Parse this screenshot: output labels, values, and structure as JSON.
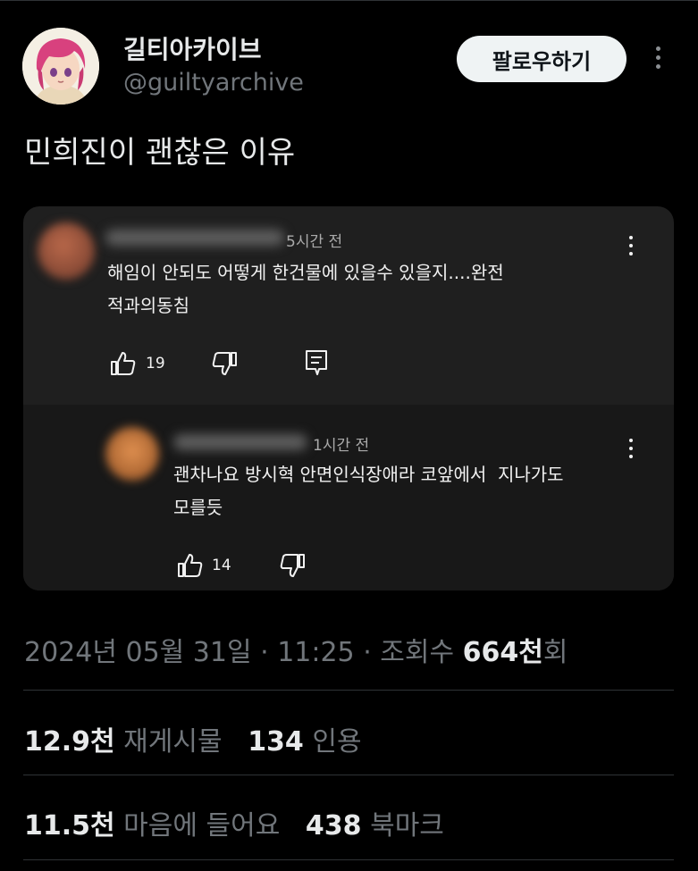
{
  "tweet": {
    "display_name": "길티아카이브",
    "handle": "@guiltyarchive",
    "follow_label": "팔로우하기",
    "text": "민희진이 괜찮은 이유",
    "meta": {
      "date": "2024년 05월 31일",
      "time": "11:25",
      "views_label": "조회수",
      "views_value": "664천",
      "views_unit": "회"
    },
    "stats": {
      "reposts_value": "12.9천",
      "reposts_label": "재게시물",
      "quotes_value": "134",
      "quotes_label": "인용",
      "likes_value": "11.5천",
      "likes_label": "마음에 들어요",
      "bookmarks_value": "438",
      "bookmarks_label": "북마크"
    }
  },
  "media": {
    "comment": {
      "time": "5시간 전",
      "line1": "해임이 안되도 어떻게 한건물에 있을수 있을지....완전",
      "line2": "적과의동침",
      "likes": "19"
    },
    "reply": {
      "time": "1시간 전",
      "line1": "괜차나요 방시혁 안면인식장애라 코앞에서  지나가도",
      "line2": "모를듯",
      "likes": "14"
    }
  },
  "icons": {
    "more": "more-vertical-icon",
    "thumb_up": "thumb-up-icon",
    "thumb_down": "thumb-down-icon",
    "reply": "reply-comment-icon"
  }
}
